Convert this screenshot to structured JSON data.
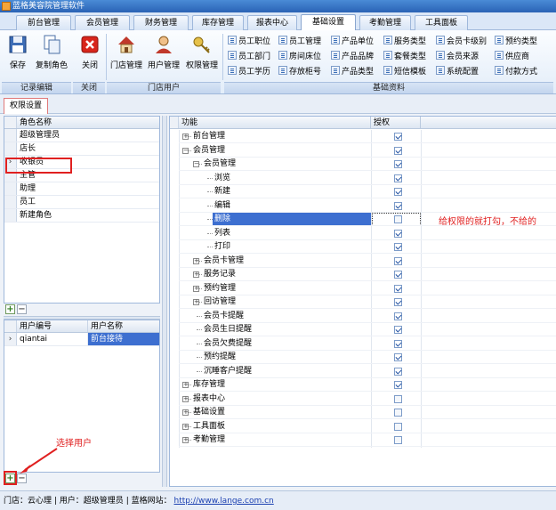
{
  "window": {
    "title": "蓝格美容院管理软件"
  },
  "tabs": [
    "前台管理",
    "会员管理",
    "财务管理",
    "库存管理",
    "报表中心",
    "基础设置",
    "考勤管理",
    "工具面板"
  ],
  "active_tab": "基础设置",
  "ribbon": {
    "buttons": {
      "save": "保存",
      "copy_role": "复制角色",
      "close": "关闭",
      "store_mgmt": "门店管理",
      "user_mgmt": "用户管理",
      "perm_mgmt": "权限管理"
    },
    "small_items": [
      [
        "员工职位",
        "员工管理",
        "产品单位",
        "服务类型",
        "会员卡级别",
        "预约类型"
      ],
      [
        "员工部门",
        "房间床位",
        "产品品牌",
        "套餐类型",
        "会员来源",
        "供应商"
      ],
      [
        "员工学历",
        "存放柜号",
        "产品类型",
        "短信模板",
        "系统配置",
        "付款方式"
      ]
    ],
    "groups": {
      "record_edit": "记录编辑",
      "close": "关闭",
      "store_user": "门店用户",
      "basic_data": "基础资料"
    }
  },
  "subtab": "权限设置",
  "roles": {
    "header": "角色名称",
    "items": [
      "超级管理员",
      "店长",
      "收银员",
      "主管",
      "助理",
      "员工",
      "新建角色"
    ],
    "selected_index": 2
  },
  "users": {
    "headers": [
      "用户编号",
      "用户名称"
    ],
    "rows": [
      [
        "qiantai",
        "前台接待"
      ]
    ]
  },
  "permissions": {
    "headers": [
      "功能",
      "授权"
    ],
    "rows": [
      {
        "label": "前台管理",
        "checked": true
      },
      {
        "label": "会员管理",
        "checked": true
      },
      {
        "label": "会员管理",
        "checked": true
      },
      {
        "label": "浏览",
        "checked": true
      },
      {
        "label": "新建",
        "checked": true
      },
      {
        "label": "编辑",
        "checked": true
      },
      {
        "label": "删除",
        "checked": false
      },
      {
        "label": "列表",
        "checked": true
      },
      {
        "label": "打印",
        "checked": true
      },
      {
        "label": "会员卡管理",
        "checked": true
      },
      {
        "label": "服务记录",
        "checked": true
      },
      {
        "label": "预约管理",
        "checked": true
      },
      {
        "label": "回访管理",
        "checked": true
      },
      {
        "label": "会员卡提醒",
        "checked": true
      },
      {
        "label": "会员生日提醒",
        "checked": true
      },
      {
        "label": "会员欠费提醒",
        "checked": true
      },
      {
        "label": "预约提醒",
        "checked": true
      },
      {
        "label": "沉睡客户提醒",
        "checked": true
      },
      {
        "label": "库存管理",
        "checked": true
      },
      {
        "label": "报表中心",
        "checked": false
      },
      {
        "label": "基础设置",
        "checked": false
      },
      {
        "label": "工具面板",
        "checked": false
      },
      {
        "label": "考勤管理",
        "checked": false
      }
    ]
  },
  "annotations": {
    "permission_hint": "给权限的就打勾，不给的",
    "select_user": "选择用户"
  },
  "status": {
    "store": "门店：云心理",
    "user": "用户：超级管理员",
    "site_label": "蓝格网站：",
    "site_url": "http://www.lange.com.cn"
  },
  "colors": {
    "accent": "#3d6fd0",
    "annotation": "#e02020"
  }
}
